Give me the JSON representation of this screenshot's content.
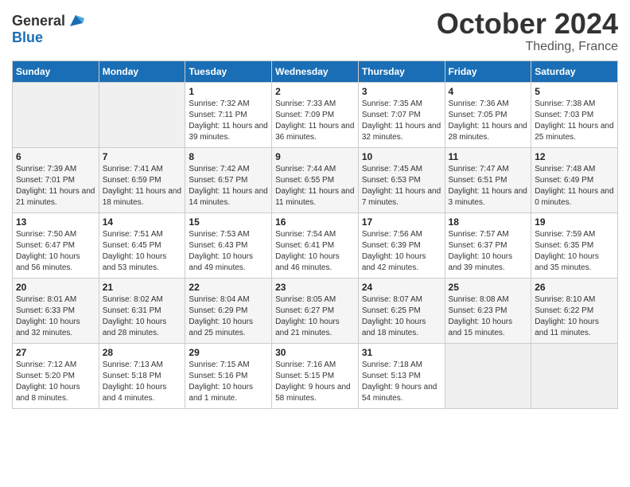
{
  "header": {
    "logo": {
      "general": "General",
      "blue": "Blue"
    },
    "title": "October 2024",
    "subtitle": "Theding, France"
  },
  "days_of_week": [
    "Sunday",
    "Monday",
    "Tuesday",
    "Wednesday",
    "Thursday",
    "Friday",
    "Saturday"
  ],
  "weeks": [
    [
      {
        "day": "",
        "sunrise": "",
        "sunset": "",
        "daylight": ""
      },
      {
        "day": "",
        "sunrise": "",
        "sunset": "",
        "daylight": ""
      },
      {
        "day": "1",
        "sunrise": "Sunrise: 7:32 AM",
        "sunset": "Sunset: 7:11 PM",
        "daylight": "Daylight: 11 hours and 39 minutes."
      },
      {
        "day": "2",
        "sunrise": "Sunrise: 7:33 AM",
        "sunset": "Sunset: 7:09 PM",
        "daylight": "Daylight: 11 hours and 36 minutes."
      },
      {
        "day": "3",
        "sunrise": "Sunrise: 7:35 AM",
        "sunset": "Sunset: 7:07 PM",
        "daylight": "Daylight: 11 hours and 32 minutes."
      },
      {
        "day": "4",
        "sunrise": "Sunrise: 7:36 AM",
        "sunset": "Sunset: 7:05 PM",
        "daylight": "Daylight: 11 hours and 28 minutes."
      },
      {
        "day": "5",
        "sunrise": "Sunrise: 7:38 AM",
        "sunset": "Sunset: 7:03 PM",
        "daylight": "Daylight: 11 hours and 25 minutes."
      }
    ],
    [
      {
        "day": "6",
        "sunrise": "Sunrise: 7:39 AM",
        "sunset": "Sunset: 7:01 PM",
        "daylight": "Daylight: 11 hours and 21 minutes."
      },
      {
        "day": "7",
        "sunrise": "Sunrise: 7:41 AM",
        "sunset": "Sunset: 6:59 PM",
        "daylight": "Daylight: 11 hours and 18 minutes."
      },
      {
        "day": "8",
        "sunrise": "Sunrise: 7:42 AM",
        "sunset": "Sunset: 6:57 PM",
        "daylight": "Daylight: 11 hours and 14 minutes."
      },
      {
        "day": "9",
        "sunrise": "Sunrise: 7:44 AM",
        "sunset": "Sunset: 6:55 PM",
        "daylight": "Daylight: 11 hours and 11 minutes."
      },
      {
        "day": "10",
        "sunrise": "Sunrise: 7:45 AM",
        "sunset": "Sunset: 6:53 PM",
        "daylight": "Daylight: 11 hours and 7 minutes."
      },
      {
        "day": "11",
        "sunrise": "Sunrise: 7:47 AM",
        "sunset": "Sunset: 6:51 PM",
        "daylight": "Daylight: 11 hours and 3 minutes."
      },
      {
        "day": "12",
        "sunrise": "Sunrise: 7:48 AM",
        "sunset": "Sunset: 6:49 PM",
        "daylight": "Daylight: 11 hours and 0 minutes."
      }
    ],
    [
      {
        "day": "13",
        "sunrise": "Sunrise: 7:50 AM",
        "sunset": "Sunset: 6:47 PM",
        "daylight": "Daylight: 10 hours and 56 minutes."
      },
      {
        "day": "14",
        "sunrise": "Sunrise: 7:51 AM",
        "sunset": "Sunset: 6:45 PM",
        "daylight": "Daylight: 10 hours and 53 minutes."
      },
      {
        "day": "15",
        "sunrise": "Sunrise: 7:53 AM",
        "sunset": "Sunset: 6:43 PM",
        "daylight": "Daylight: 10 hours and 49 minutes."
      },
      {
        "day": "16",
        "sunrise": "Sunrise: 7:54 AM",
        "sunset": "Sunset: 6:41 PM",
        "daylight": "Daylight: 10 hours and 46 minutes."
      },
      {
        "day": "17",
        "sunrise": "Sunrise: 7:56 AM",
        "sunset": "Sunset: 6:39 PM",
        "daylight": "Daylight: 10 hours and 42 minutes."
      },
      {
        "day": "18",
        "sunrise": "Sunrise: 7:57 AM",
        "sunset": "Sunset: 6:37 PM",
        "daylight": "Daylight: 10 hours and 39 minutes."
      },
      {
        "day": "19",
        "sunrise": "Sunrise: 7:59 AM",
        "sunset": "Sunset: 6:35 PM",
        "daylight": "Daylight: 10 hours and 35 minutes."
      }
    ],
    [
      {
        "day": "20",
        "sunrise": "Sunrise: 8:01 AM",
        "sunset": "Sunset: 6:33 PM",
        "daylight": "Daylight: 10 hours and 32 minutes."
      },
      {
        "day": "21",
        "sunrise": "Sunrise: 8:02 AM",
        "sunset": "Sunset: 6:31 PM",
        "daylight": "Daylight: 10 hours and 28 minutes."
      },
      {
        "day": "22",
        "sunrise": "Sunrise: 8:04 AM",
        "sunset": "Sunset: 6:29 PM",
        "daylight": "Daylight: 10 hours and 25 minutes."
      },
      {
        "day": "23",
        "sunrise": "Sunrise: 8:05 AM",
        "sunset": "Sunset: 6:27 PM",
        "daylight": "Daylight: 10 hours and 21 minutes."
      },
      {
        "day": "24",
        "sunrise": "Sunrise: 8:07 AM",
        "sunset": "Sunset: 6:25 PM",
        "daylight": "Daylight: 10 hours and 18 minutes."
      },
      {
        "day": "25",
        "sunrise": "Sunrise: 8:08 AM",
        "sunset": "Sunset: 6:23 PM",
        "daylight": "Daylight: 10 hours and 15 minutes."
      },
      {
        "day": "26",
        "sunrise": "Sunrise: 8:10 AM",
        "sunset": "Sunset: 6:22 PM",
        "daylight": "Daylight: 10 hours and 11 minutes."
      }
    ],
    [
      {
        "day": "27",
        "sunrise": "Sunrise: 7:12 AM",
        "sunset": "Sunset: 5:20 PM",
        "daylight": "Daylight: 10 hours and 8 minutes."
      },
      {
        "day": "28",
        "sunrise": "Sunrise: 7:13 AM",
        "sunset": "Sunset: 5:18 PM",
        "daylight": "Daylight: 10 hours and 4 minutes."
      },
      {
        "day": "29",
        "sunrise": "Sunrise: 7:15 AM",
        "sunset": "Sunset: 5:16 PM",
        "daylight": "Daylight: 10 hours and 1 minute."
      },
      {
        "day": "30",
        "sunrise": "Sunrise: 7:16 AM",
        "sunset": "Sunset: 5:15 PM",
        "daylight": "Daylight: 9 hours and 58 minutes."
      },
      {
        "day": "31",
        "sunrise": "Sunrise: 7:18 AM",
        "sunset": "Sunset: 5:13 PM",
        "daylight": "Daylight: 9 hours and 54 minutes."
      },
      {
        "day": "",
        "sunrise": "",
        "sunset": "",
        "daylight": ""
      },
      {
        "day": "",
        "sunrise": "",
        "sunset": "",
        "daylight": ""
      }
    ]
  ]
}
